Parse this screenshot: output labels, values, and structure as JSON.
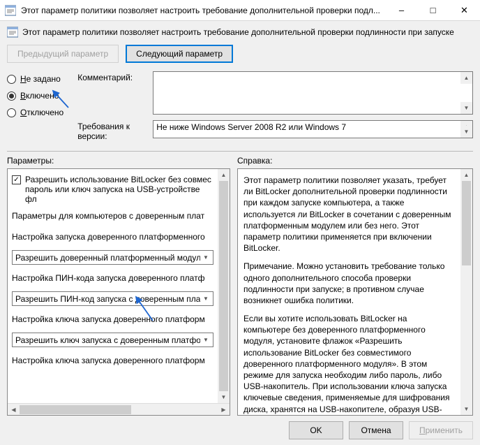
{
  "window": {
    "title": "Этот параметр политики позволяет настроить требование дополнительной проверки подл...",
    "header": "Этот параметр политики позволяет настроить требование дополнительной проверки подлинности при запуске"
  },
  "nav": {
    "prev": "Предыдущий параметр",
    "next": "Следующий параметр"
  },
  "state": {
    "not_configured_prefix": "Н",
    "not_configured_rest": "е задано",
    "enabled_prefix": "В",
    "enabled_rest": "ключено",
    "disabled_prefix": "О",
    "disabled_rest": "тключено",
    "selected": "enabled"
  },
  "fields": {
    "comment_label": "Комментарий:",
    "comment_value": "",
    "requirements_label": "Требования к версии:",
    "requirements_value": "Не ниже Windows Server 2008 R2 или Windows 7"
  },
  "sections": {
    "options": "Параметры:",
    "help": "Справка:"
  },
  "options": {
    "checkbox_checked": true,
    "checkbox_line1": "Разрешить использование BitLocker без совмес",
    "checkbox_line2": "пароль или ключ запуска на USB-устройстве фл",
    "group_label": "Параметры для компьютеров с доверенным плат",
    "row_tpm_label": "Настройка запуска доверенного платформенного",
    "row_tpm_value": "Разрешить доверенный платформенный модуль",
    "row_pin_label": "Настройка ПИН-кода запуска доверенного платф",
    "row_pin_value": "Разрешить ПИН-код запуска с доверенным плат",
    "row_key_label": "Настройка ключа запуска доверенного платформ",
    "row_key_value": "Разрешить ключ запуска с доверенным платформ",
    "row_keypin_label": "Настройка ключа запуска доверенного платформ"
  },
  "help": {
    "p1": "Этот параметр политики позволяет указать, требует ли BitLocker дополнительной проверки подлинности при каждом запуске компьютера, а также используется ли BitLocker в сочетании с доверенным платформенным модулем или без него. Этот параметр политики применяется при включении BitLocker.",
    "p2": "Примечание. Можно установить требование только одного дополнительного способа проверки подлинности при запуске; в противном случае возникнет ошибка политики.",
    "p3": "Если вы хотите использовать BitLocker на компьютере без доверенного платформенного модуля, установите флажок «Разрешить использование BitLocker без совместимого доверенного платформенного модуля». В этом режиме для запуска необходим либо пароль, либо USB-накопитель. При использовании ключа запуска ключевые сведения, применяемые для шифрования диска, хранятся на USB-накопителе, образуя USB-ключ. При установке USB-ключа"
  },
  "footer": {
    "ok": "OK",
    "cancel": "Отмена",
    "apply_prefix": "П",
    "apply_rest": "рименить"
  },
  "checkmark": "✓"
}
